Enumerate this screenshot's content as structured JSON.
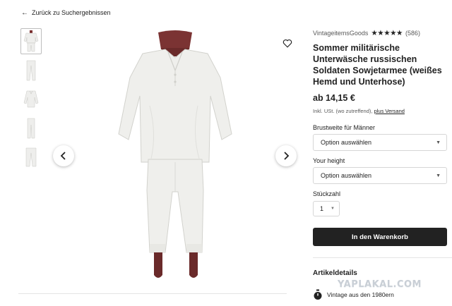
{
  "nav": {
    "back_label": "Zurück zu Suchergebnissen"
  },
  "product": {
    "shop_name": "VintageitemsGoods",
    "stars": "★★★★★",
    "rating": 5,
    "rating_count": "(586)",
    "title": "Sommer militärische Unterwäsche russischen Soldaten Sowjetarmee (weißes Hemd und Unterhose)",
    "price": "ab 14,15 €",
    "tax_note": "Inkl. USt. (wo zutreffend),",
    "shipping_link": "plus Versand"
  },
  "options": {
    "chest_label": "Brustweite für Männer",
    "chest_value": "Option auswählen",
    "height_label": "Your height",
    "height_value": "Option auswählen",
    "qty_label": "Stückzahl",
    "qty_value": "1"
  },
  "actions": {
    "add_to_cart": "In den Warenkorb"
  },
  "details": {
    "title": "Artikeldetails",
    "vintage_text": "Vintage aus den 1980ern"
  },
  "gallery": {
    "thumbnail_count": 5,
    "active_index": 0
  },
  "watermark": "YAPLAKAL.COM",
  "icons": {
    "back": "arrow-left-icon",
    "prev": "chevron-left-icon",
    "next": "chevron-right-icon",
    "favorite": "heart-icon",
    "vintage": "stopwatch-icon",
    "select": "triangle-down-icon"
  },
  "colors": {
    "primary_button": "#222222",
    "star": "#222222",
    "border": "#d6d6d6"
  }
}
